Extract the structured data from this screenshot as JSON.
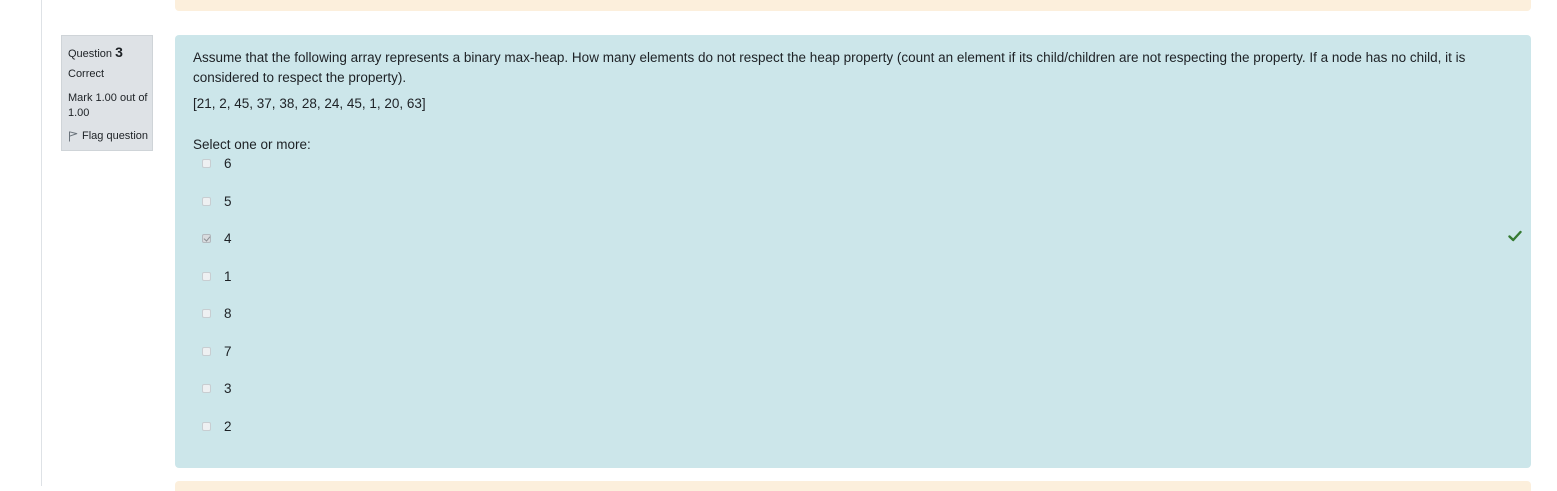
{
  "question": {
    "label": "Question",
    "number": "3",
    "state": "Correct",
    "grade": "Mark 1.00 out of 1.00",
    "flag_label": "Flag question",
    "text": "Assume that the following array represents a binary max-heap. How many elements do not respect the heap property (count an element if its child/children are not respecting the property. If a node has no child, it is considered to respect the property).",
    "array": "[21, 2, 45, 37, 38, 28, 24, 45, 1, 20, 63]",
    "prompt": "Select one or more:",
    "answers": [
      {
        "label": "6",
        "checked": false
      },
      {
        "label": "5",
        "checked": false
      },
      {
        "label": "4",
        "checked": true,
        "correct_mark": true
      },
      {
        "label": "1",
        "checked": false
      },
      {
        "label": "8",
        "checked": false
      },
      {
        "label": "7",
        "checked": false
      },
      {
        "label": "3",
        "checked": false
      },
      {
        "label": "2",
        "checked": false
      }
    ]
  },
  "colors": {
    "content_bg": "#cce6ea",
    "info_bg": "#dee2e6",
    "neighbor_question_bg": "#fcefdc",
    "correct_check": "#357a32"
  },
  "icons": {
    "flag": "flag-icon",
    "correct": "check-icon"
  }
}
